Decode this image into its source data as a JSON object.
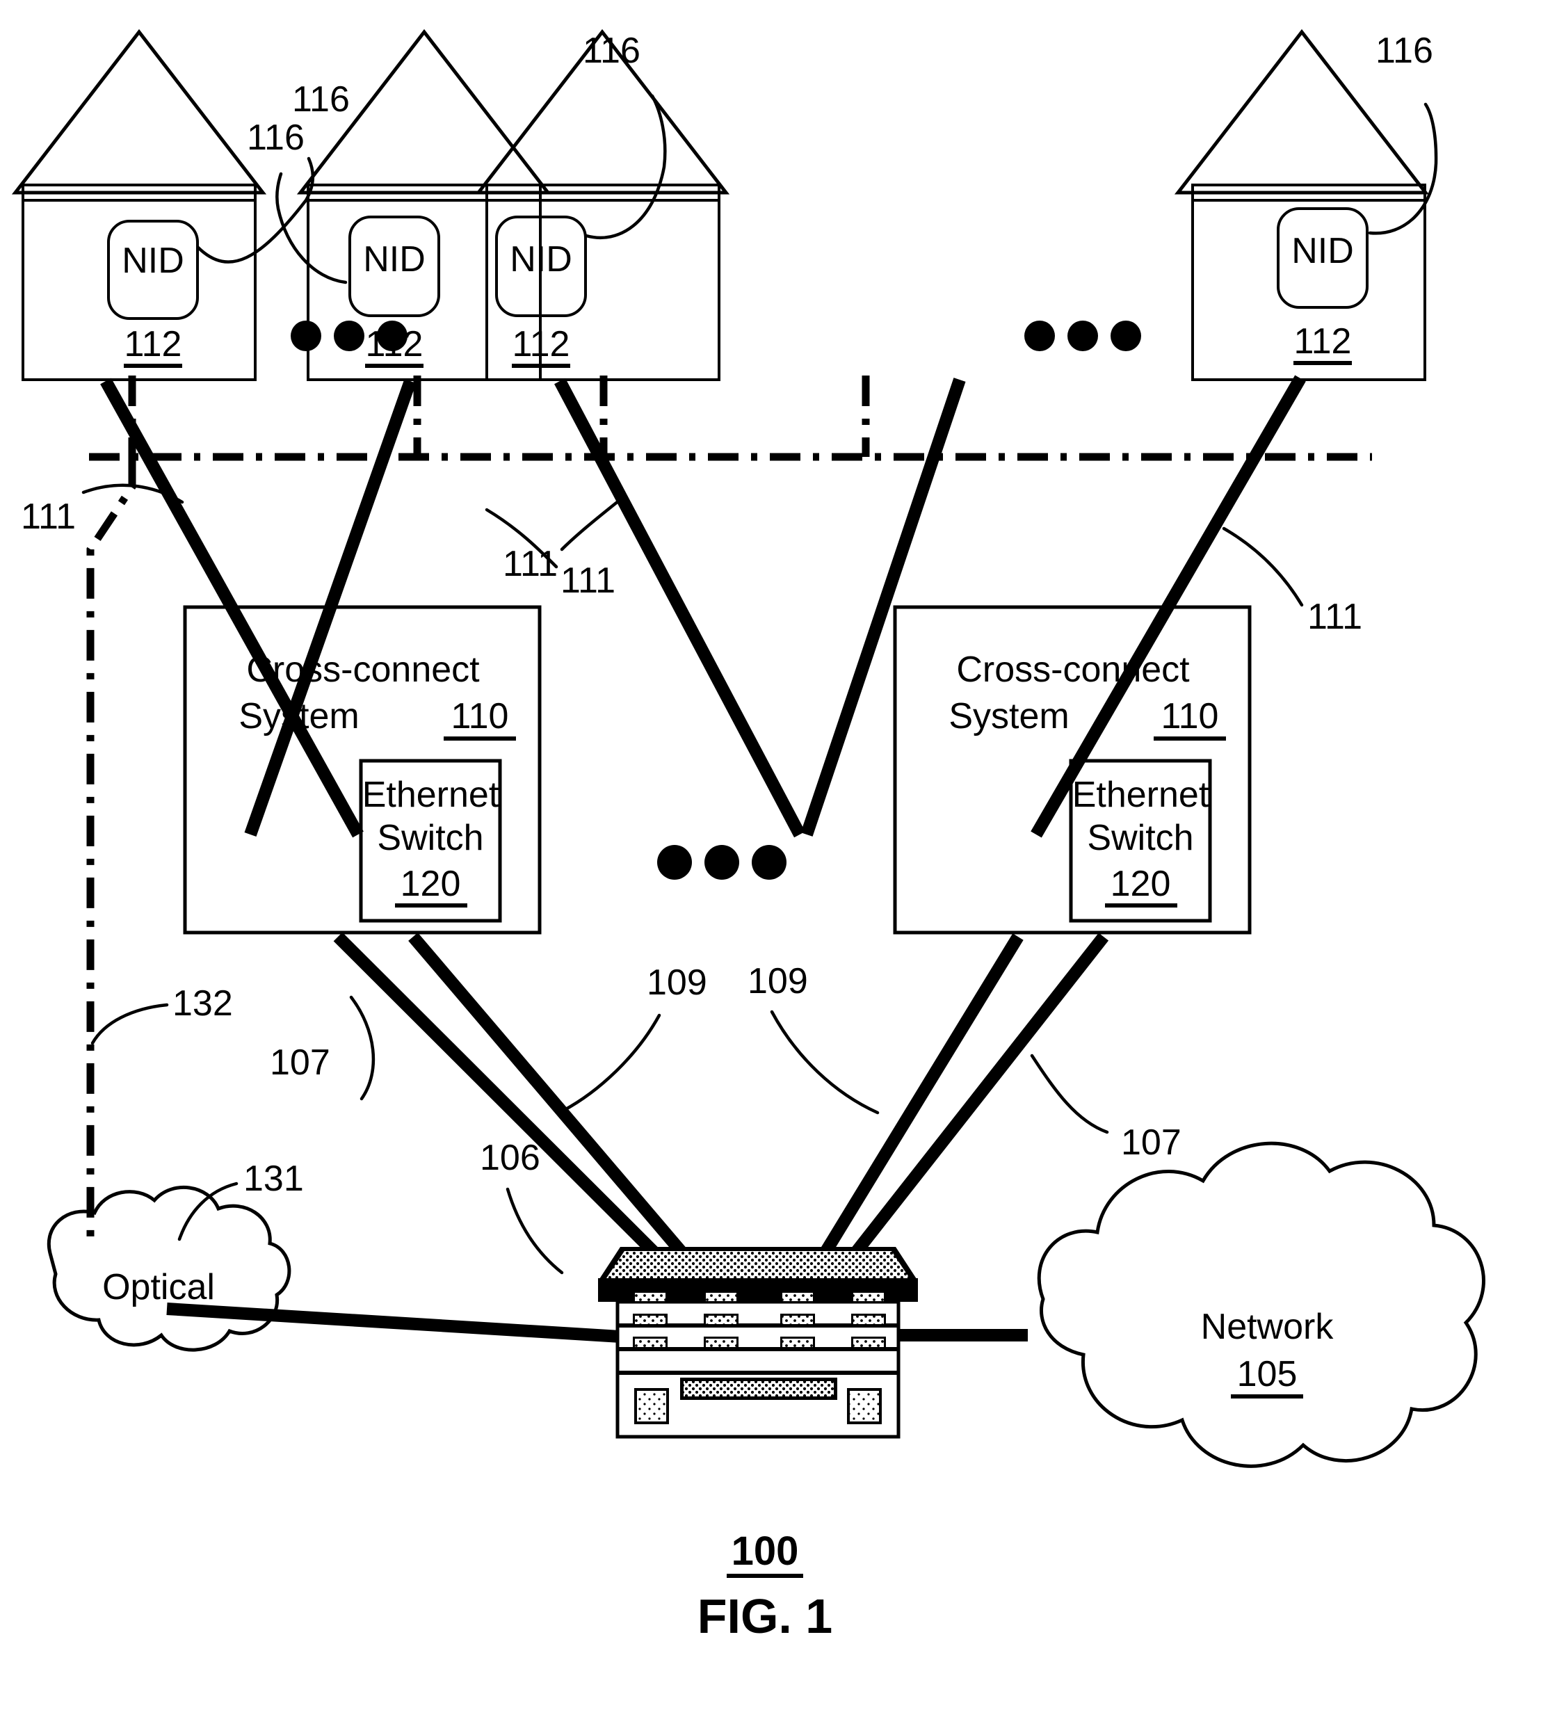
{
  "figure": {
    "caption": "FIG. 1",
    "system_number": "100"
  },
  "premises": [
    {
      "id": "house-1",
      "device_label": "NID",
      "device_ref": "116",
      "premise_ref": "112"
    },
    {
      "id": "house-2",
      "device_label": "NID",
      "device_ref": "116",
      "premise_ref": "112"
    },
    {
      "id": "house-3",
      "device_label": "NID",
      "device_ref": "116",
      "premise_ref": "112"
    },
    {
      "id": "house-4",
      "device_label": "NID",
      "device_ref": "116",
      "premise_ref": "112"
    }
  ],
  "cross_connect_systems": [
    {
      "id": "cross-connect-left",
      "title_line1": "Cross-connect",
      "title_line2": "System",
      "ref": "110",
      "switch": {
        "line1": "Ethernet",
        "line2": "Switch",
        "ref": "120"
      }
    },
    {
      "id": "cross-connect-right",
      "title_line1": "Cross-connect",
      "title_line2": "System",
      "ref": "110",
      "switch": {
        "line1": "Ethernet",
        "line2": "Switch",
        "ref": "120"
      }
    }
  ],
  "clouds": [
    {
      "id": "optical-cloud",
      "label": "Optical",
      "ref": "131"
    },
    {
      "id": "network-cloud",
      "label": "Network",
      "ref": "105"
    }
  ],
  "router": {
    "id": "aggregation-router",
    "ref": "106"
  },
  "link_refs": {
    "drop_link": "111",
    "uplink_a": "107",
    "uplink_b": "109",
    "optical_link": "132"
  },
  "callouts": {
    "ref_116_h1": "116",
    "ref_116_h2": "116",
    "ref_116_h3": "116",
    "ref_116_h4": "116",
    "ref_112_h1": "112",
    "ref_112_h2": "112",
    "ref_112_h3": "112",
    "ref_112_h4": "112",
    "ref_111_a": "111",
    "ref_111_b": "111",
    "ref_111_c": "111",
    "ref_111_d": "111",
    "ref_107_left": "107",
    "ref_109_left": "109",
    "ref_109_right": "109",
    "ref_107_right": "107",
    "ref_106": "106",
    "ref_131": "131",
    "ref_132": "132",
    "ref_110_left": "110",
    "ref_110_right": "110",
    "ref_120_left": "120",
    "ref_120_right": "120",
    "ref_105": "105",
    "ref_100": "100"
  },
  "ellipses": [
    {
      "id": "ellipsis-houses-left",
      "dots": 3
    },
    {
      "id": "ellipsis-houses-right",
      "dots": 3
    },
    {
      "id": "ellipsis-cross-connect",
      "dots": 3
    }
  ],
  "colors": {
    "ink": "#000000",
    "paper": "#ffffff"
  }
}
